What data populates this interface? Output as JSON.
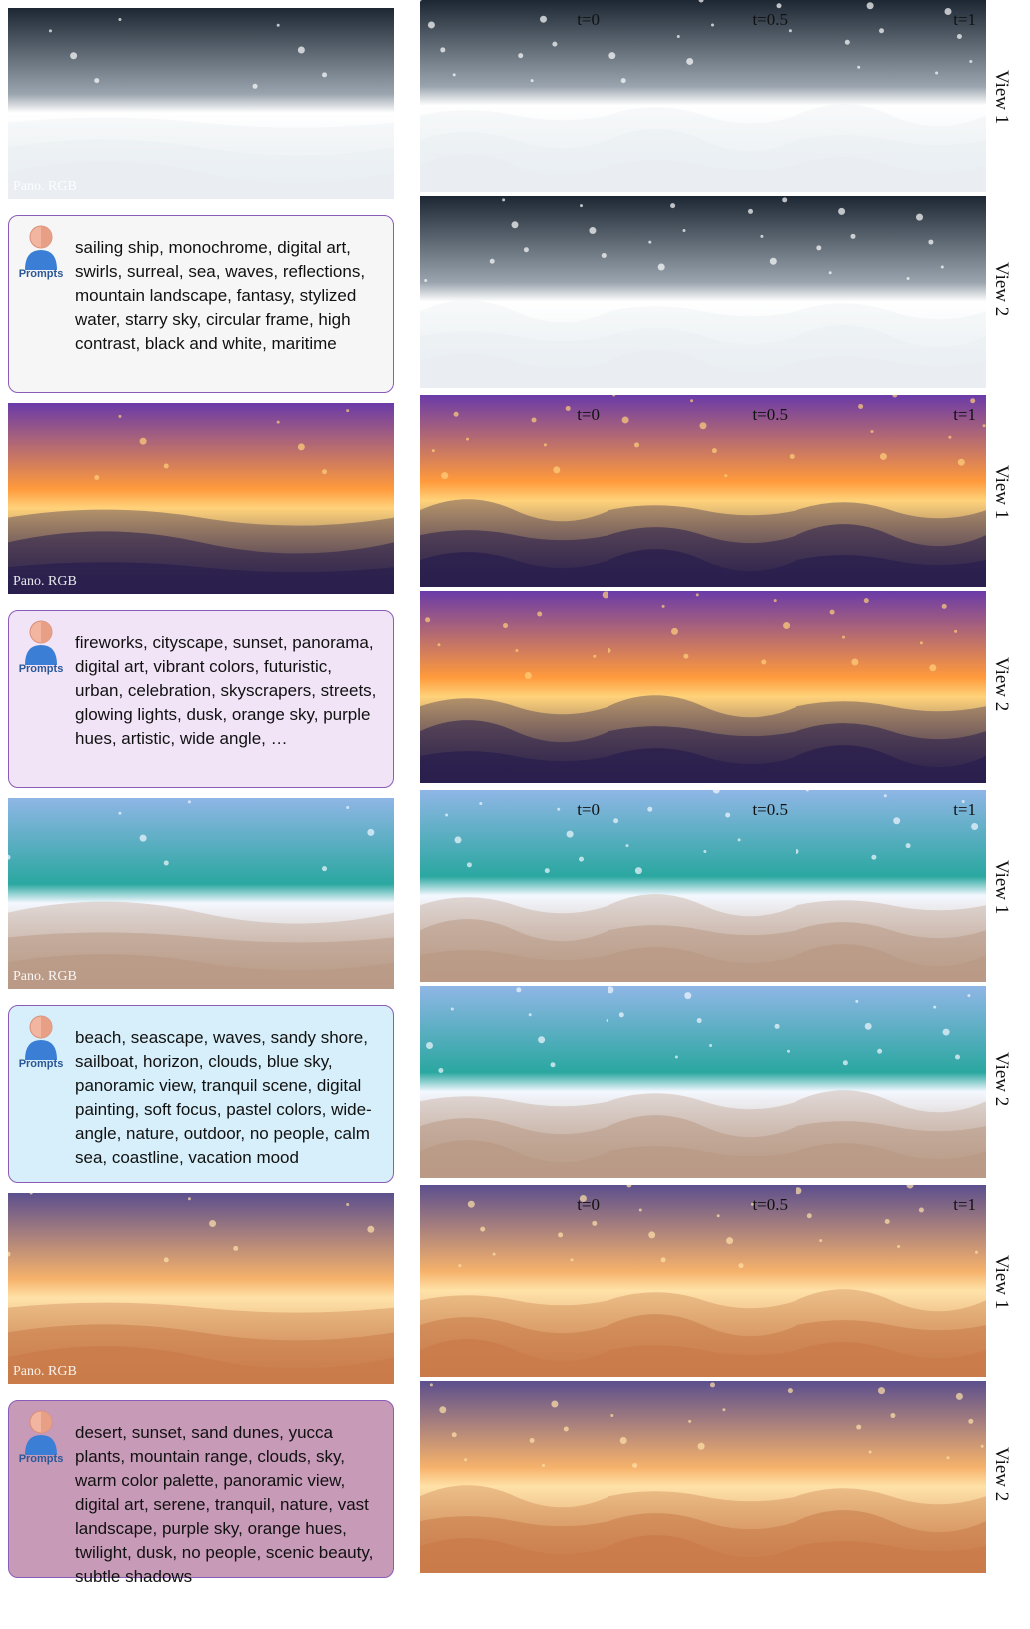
{
  "rows": [
    {
      "pano_label": "Pano. RGB",
      "prompt_icon_label": "Prompts",
      "prompt": "sailing ship, monochrome, digital art, swirls, surreal, sea, waves, reflections, mountain landscape, fantasy, stylized water, starry sky, circular frame, high contrast, black and white, maritime",
      "times": [
        "t=0",
        "t=0.5",
        "t=1"
      ],
      "views": [
        "View 1",
        "View 2"
      ],
      "colors": {
        "box_bg": "#f6f6f6",
        "sky": "#1d2733",
        "mid": "#9aa4ae",
        "ground": "#e9eef2",
        "accent": "#ffffff"
      }
    },
    {
      "pano_label": "Pano. RGB",
      "prompt_icon_label": "Prompts",
      "prompt": "fireworks, cityscape, sunset, panorama, digital art, vibrant colors, futuristic, urban, celebration, skyscrapers, streets, glowing lights, dusk, orange sky, purple hues, artistic, wide angle, …",
      "times": [
        "t=0",
        "t=0.5",
        "t=1"
      ],
      "views": [
        "View 1",
        "View 2"
      ],
      "colors": {
        "box_bg": "#f1e4f7",
        "sky": "#6a3aa8",
        "mid": "#ff9a3c",
        "ground": "#2a1f4d",
        "accent": "#ffd27a"
      }
    },
    {
      "pano_label": "Pano. RGB",
      "prompt_icon_label": "Prompts",
      "prompt": "beach, seascape, waves, sandy shore, sailboat, horizon, clouds, blue sky, panoramic view, tranquil scene, digital painting, soft focus, pastel colors, wide-angle, nature, outdoor, no people, calm sea, coastline, vacation mood",
      "times": [
        "t=0",
        "t=0.5",
        "t=1"
      ],
      "views": [
        "View 1",
        "View 2"
      ],
      "colors": {
        "box_bg": "#d6effa",
        "sky": "#8fb6e6",
        "mid": "#2aa7a0",
        "ground": "#b99a86",
        "accent": "#f4f8ff"
      }
    },
    {
      "pano_label": "Pano. RGB",
      "prompt_icon_label": "Prompts",
      "prompt": "desert, sunset, sand dunes, yucca plants, mountain range, clouds, sky, warm color palette, panoramic view, digital art, serene, tranquil, nature, vast landscape, purple sky, orange hues, twilight, dusk, no people, scenic beauty, subtle shadows",
      "times": [
        "t=0",
        "t=0.5",
        "t=1"
      ],
      "views": [
        "View 1",
        "View 2"
      ],
      "colors": {
        "box_bg": "#c79ab8",
        "sky": "#5c4f8e",
        "mid": "#f6b26b",
        "ground": "#c97b4a",
        "accent": "#ffe2a8"
      }
    }
  ]
}
